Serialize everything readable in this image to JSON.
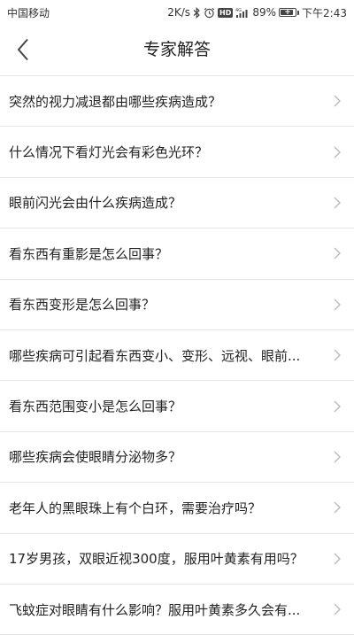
{
  "status_bar": {
    "carrier": "中国移动",
    "network_speed": "2K/s",
    "network_type": "4G",
    "battery_percent": "89%",
    "battery_level": 0.89,
    "time": "下午2:43",
    "icons": [
      "bluetooth-icon",
      "alarm-icon",
      "hd-icon",
      "signal-icon",
      "battery-icon"
    ]
  },
  "header": {
    "title": "专家解答",
    "back_icon": "chevron-left-icon"
  },
  "faq": {
    "items": [
      {
        "question": "突然的视力减退都由哪些疾病造成？"
      },
      {
        "question": "什么情况下看灯光会有彩色光环？"
      },
      {
        "question": "眼前闪光会由什么疾病造成？"
      },
      {
        "question": "看东西有重影是怎么回事？"
      },
      {
        "question": "看东西变形是怎么回事？"
      },
      {
        "question": "哪些疾病可引起看东西变小、变形、远视、眼前..."
      },
      {
        "question": "看东西范围变小是怎么回事？"
      },
      {
        "question": "哪些疾病会使眼睛分泌物多？"
      },
      {
        "question": "老年人的黑眼珠上有个白环，需要治疗吗？"
      },
      {
        "question": "17岁男孩，双眼近视300度，服用叶黄素有用吗？"
      },
      {
        "question": "飞蚊症对眼睛有什么影响？服用叶黄素多久会有..."
      }
    ],
    "item_icon": "chevron-right-icon"
  },
  "colors": {
    "text": "#222222",
    "divider": "#e6e6e6",
    "chevron": "#bbbbbb"
  }
}
